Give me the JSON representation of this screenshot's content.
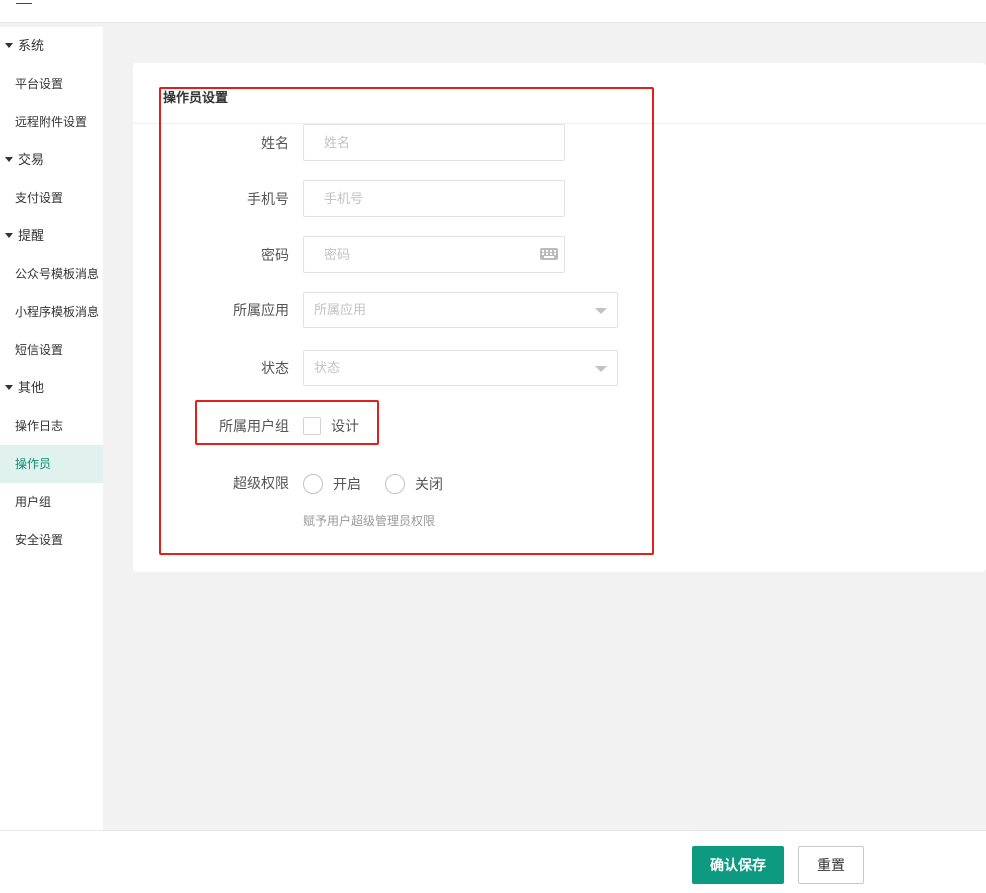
{
  "sidebar": {
    "groups": [
      {
        "label": "系统",
        "items": [
          "平台设置",
          "远程附件设置"
        ]
      },
      {
        "label": "交易",
        "items": [
          "支付设置"
        ]
      },
      {
        "label": "提醒",
        "items": [
          "公众号模板消息",
          "小程序模板消息",
          "短信设置"
        ]
      },
      {
        "label": "其他",
        "items": [
          "操作日志",
          "操作员",
          "用户组",
          "安全设置"
        ]
      }
    ],
    "active_item": "操作员"
  },
  "form": {
    "title": "操作员设置",
    "name": {
      "label": "姓名",
      "placeholder": "姓名"
    },
    "phone": {
      "label": "手机号",
      "placeholder": "手机号"
    },
    "password": {
      "label": "密码",
      "placeholder": "密码",
      "icon": "keyboard-icon"
    },
    "app": {
      "label": "所属应用",
      "placeholder": "所属应用"
    },
    "status": {
      "label": "状态",
      "placeholder": "状态"
    },
    "user_group": {
      "label": "所属用户组",
      "option": "设计",
      "checked": false
    },
    "super_permission": {
      "label": "超级权限",
      "options": [
        "开启",
        "关闭"
      ],
      "hint": "赋予用户超级管理员权限"
    }
  },
  "footer": {
    "save_label": "确认保存",
    "reset_label": "重置"
  },
  "colors": {
    "primary": "#0e9a81",
    "highlight_box": "#e0201a",
    "active_item_bg": "#e1f1ee"
  }
}
